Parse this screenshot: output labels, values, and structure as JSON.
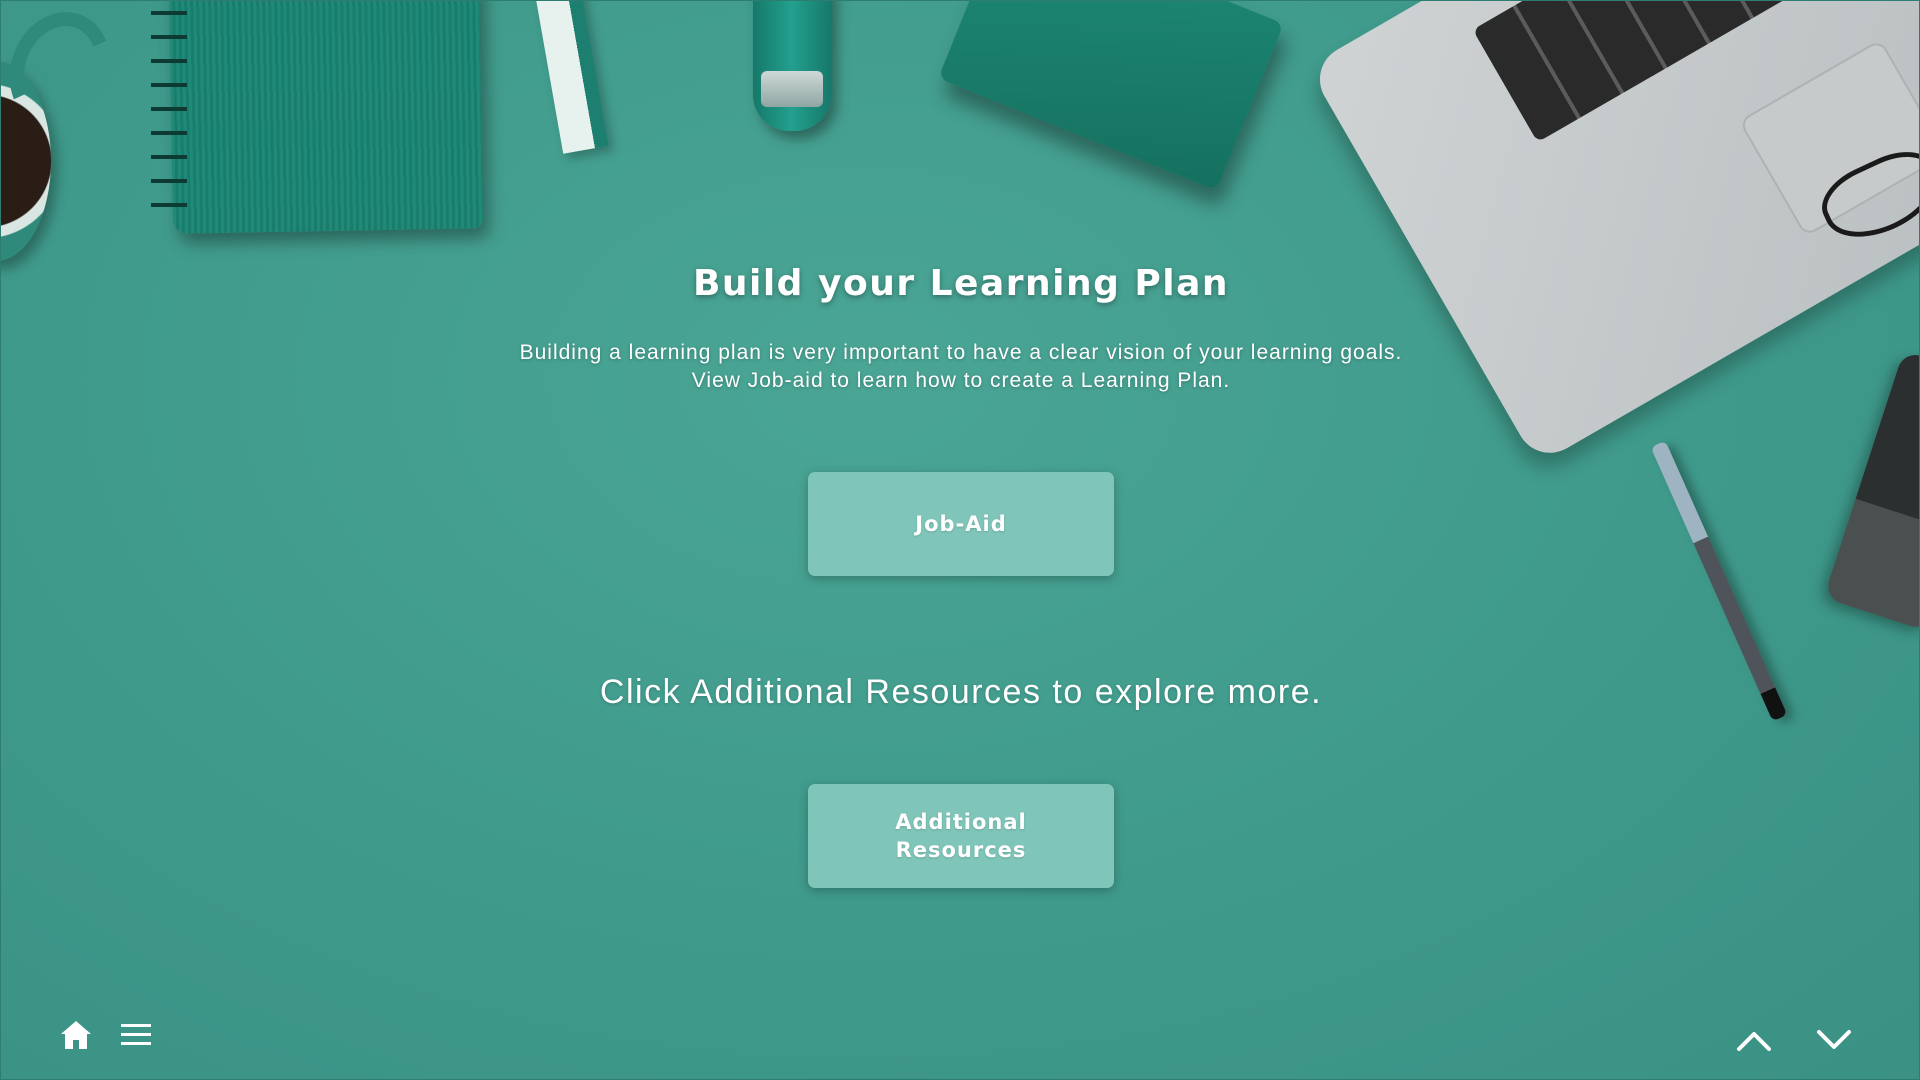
{
  "slide": {
    "title": "Build your Learning Plan",
    "description_line1": "Building a learning plan is very important to have a clear vision of your learning goals.",
    "description_line2": "View Job-aid to learn how to create a Learning Plan.",
    "explore_text": "Click Additional Resources to explore more."
  },
  "buttons": {
    "job_aid": "Job-Aid",
    "additional_resources": "Additional Resources"
  },
  "nav": {
    "icons": [
      "home-icon",
      "menu-icon",
      "chevron-up-icon",
      "chevron-down-icon"
    ]
  },
  "colors": {
    "background": "#3f9a8b",
    "button": "#7fc5b9",
    "text": "#ffffff"
  }
}
